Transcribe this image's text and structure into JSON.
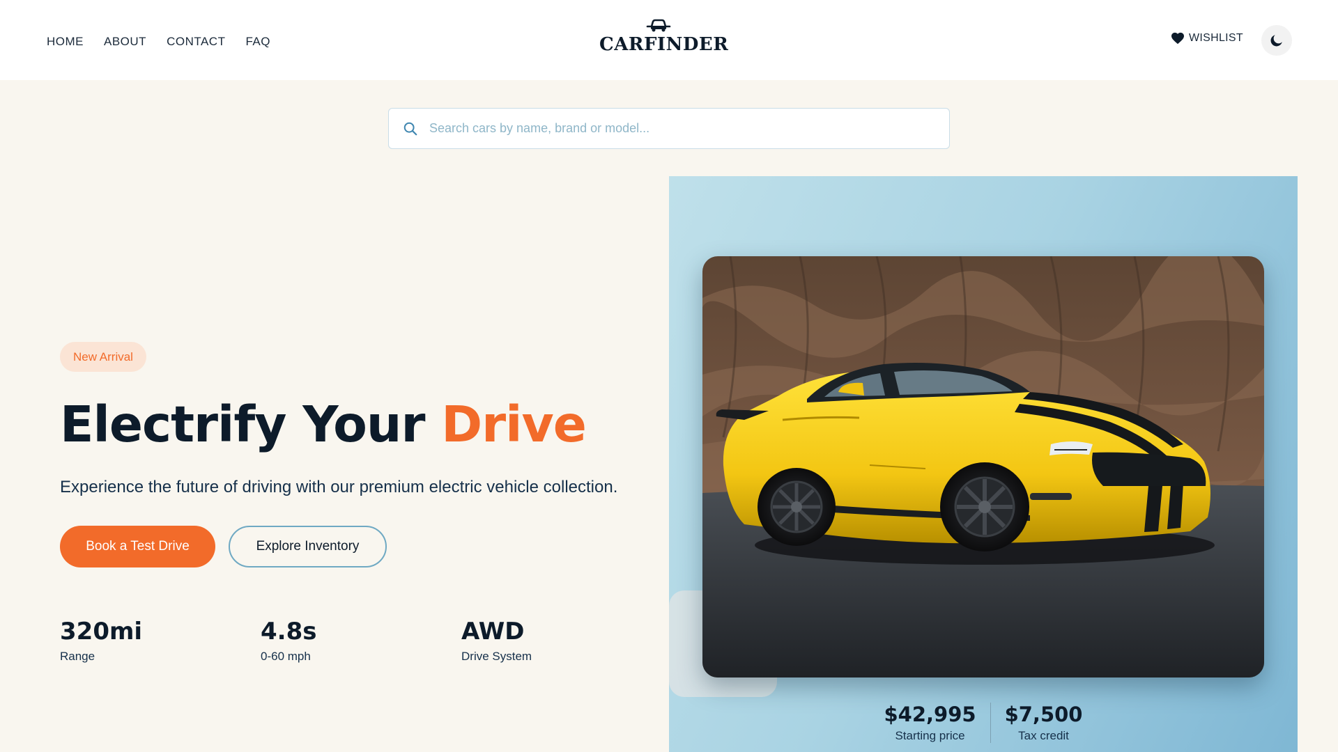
{
  "nav": {
    "items": [
      {
        "label": "HOME"
      },
      {
        "label": "ABOUT"
      },
      {
        "label": "CONTACT"
      },
      {
        "label": "FAQ"
      }
    ]
  },
  "brand": {
    "name": "CARFINDER",
    "icon": "car-icon"
  },
  "header": {
    "wishlist_label": "WISHLIST",
    "wishlist_icon": "heart-icon",
    "theme_icon": "moon-icon"
  },
  "search": {
    "placeholder": "Search cars by name, brand or model...",
    "value": "",
    "icon": "search-icon"
  },
  "hero": {
    "badge": "New Arrival",
    "title_main": "Electrify Your",
    "title_accent": "Drive",
    "subtitle": "Experience the future of driving with our premium electric vehicle collection.",
    "primary_button": "Book a Test Drive",
    "secondary_button": "Explore Inventory",
    "stats": [
      {
        "value": "320mi",
        "label": "Range"
      },
      {
        "value": "4.8s",
        "label": "0-60 mph"
      },
      {
        "value": "AWD",
        "label": "Drive System"
      }
    ]
  },
  "showcase": {
    "prices": [
      {
        "value": "$42,995",
        "label": "Starting price"
      },
      {
        "value": "$7,500",
        "label": "Tax credit"
      }
    ]
  },
  "colors": {
    "accent": "#f26b2a",
    "navy": "#0d1b2a",
    "page_background": "#f9f6ef",
    "showcase_gradient_start": "#bfe0ea",
    "showcase_gradient_end": "#7fb7d4",
    "car_body": "#f3c613"
  }
}
